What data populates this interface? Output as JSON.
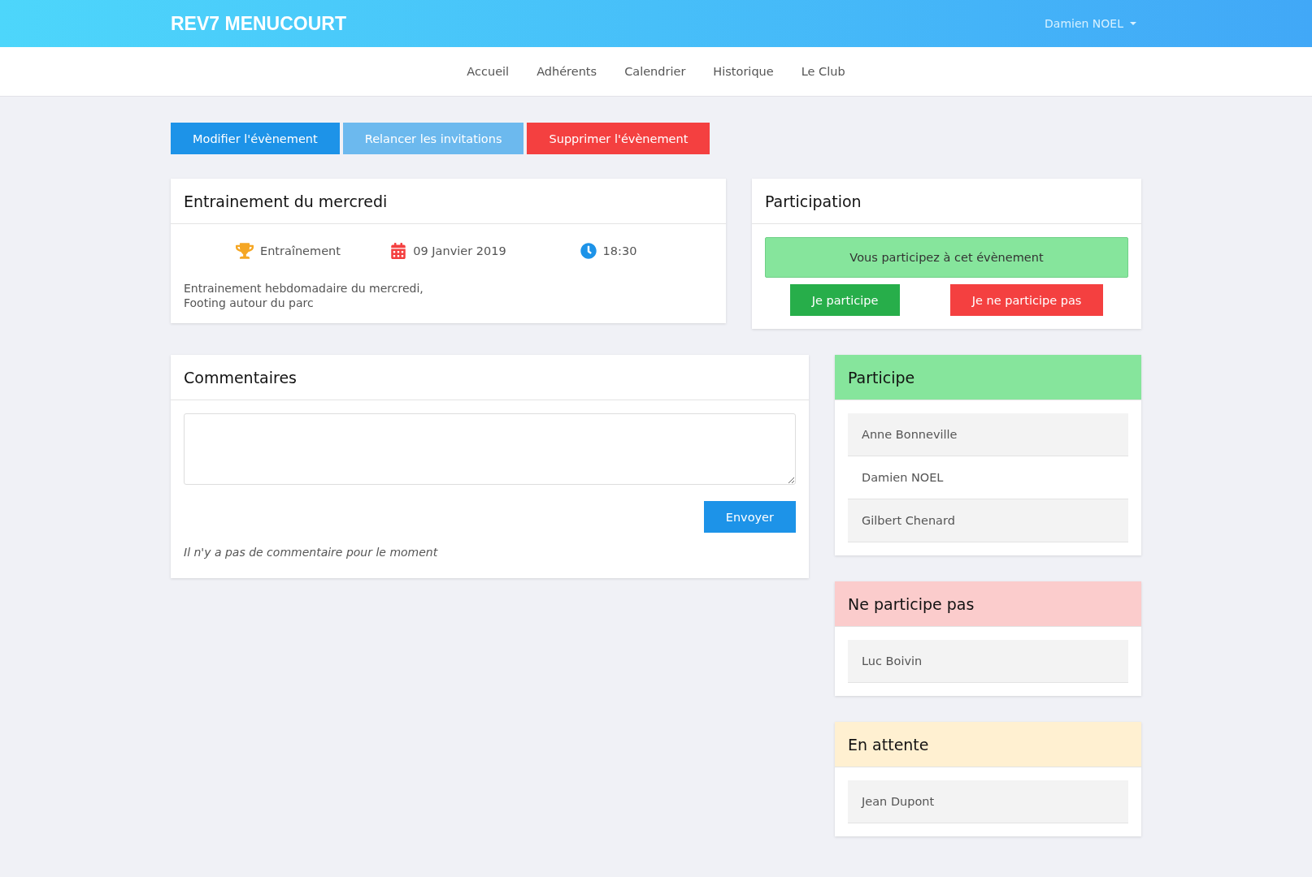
{
  "header": {
    "brand": "REV7 MENUCOURT",
    "user": "Damien NOEL"
  },
  "nav": [
    "Accueil",
    "Adhérents",
    "Calendrier",
    "Historique",
    "Le Club"
  ],
  "actions": [
    {
      "label": "Modifier l'évènement",
      "kind": "primary"
    },
    {
      "label": "Relancer les invitations",
      "kind": "light"
    },
    {
      "label": "Supprimer l'évènement",
      "kind": "danger"
    }
  ],
  "event": {
    "title": "Entrainement du mercredi",
    "type": "Entraînement",
    "date": "09 Janvier 2019",
    "time": "18:30",
    "description": [
      "Entrainement hebdomadaire du mercredi,",
      "Footing autour du parc"
    ]
  },
  "participation": {
    "title": "Participation",
    "status": "Vous participez à cet évènement",
    "buttons": [
      {
        "label": "Je participe",
        "kind": "success"
      },
      {
        "label": "Je ne participe pas",
        "kind": "danger"
      }
    ]
  },
  "comments": {
    "title": "Commentaires",
    "send": "Envoyer",
    "empty": "Il n'y a pas de commentaire pour le moment"
  },
  "groups": [
    {
      "title": "Participe",
      "color": "#86e59c",
      "members": [
        "Anne Bonneville",
        "Damien NOEL",
        "Gilbert Chenard"
      ]
    },
    {
      "title": "Ne participe pas",
      "color": "#fbcccc",
      "members": [
        "Luc Boivin"
      ]
    },
    {
      "title": "En attente",
      "color": "#fff0d1",
      "members": [
        "Jean Dupont"
      ]
    }
  ]
}
